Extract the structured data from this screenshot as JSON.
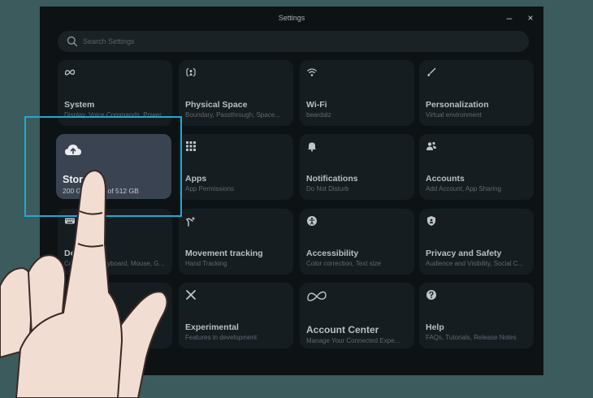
{
  "window": {
    "title": "Settings",
    "minimize_label": "–",
    "close_label": "×"
  },
  "search": {
    "placeholder": "Search Settings"
  },
  "cards": [
    {
      "title": "System",
      "subtitle": "Display, Voice Commands, Power",
      "icon": "meta-icon"
    },
    {
      "title": "Physical Space",
      "subtitle": "Boundary, Passthrough, Space...",
      "icon": "boundary-icon"
    },
    {
      "title": "Wi-Fi",
      "subtitle": "beardalz",
      "icon": "wifi-icon"
    },
    {
      "title": "Personalization",
      "subtitle": "Virtual environment",
      "icon": "brush-icon"
    },
    {
      "title": "Storage",
      "subtitle": "200 GB free of 512 GB",
      "icon": "cloud-upload-icon"
    },
    {
      "title": "Apps",
      "subtitle": "App Permissions",
      "icon": "apps-grid-icon"
    },
    {
      "title": "Notifications",
      "subtitle": "Do Not Disturb",
      "icon": "bell-icon"
    },
    {
      "title": "Accounts",
      "subtitle": "Add Account, App Sharing",
      "icon": "people-icon"
    },
    {
      "title": "Devices",
      "subtitle": "Controllers, Keyboard, Mouse, G...",
      "icon": "keyboard-icon"
    },
    {
      "title": "Movement tracking",
      "subtitle": "Hand Tracking",
      "icon": "movement-icon"
    },
    {
      "title": "Accessibility",
      "subtitle": "Color correction, Text size",
      "icon": "accessibility-icon"
    },
    {
      "title": "Privacy and Safety",
      "subtitle": "Audience and Visibility, Social C...",
      "icon": "shield-icon"
    },
    {
      "title": "",
      "subtitle": "",
      "icon": ""
    },
    {
      "title": "Experimental",
      "subtitle": "Features in development",
      "icon": "experimental-icon"
    },
    {
      "title": "Account Center",
      "subtitle": "Manage Your Connected Expe...",
      "icon": "meta-logo-icon"
    },
    {
      "title": "Help",
      "subtitle": "FAQs, Tutorials, Release Notes",
      "icon": "help-icon"
    }
  ],
  "storage_card": {
    "title": "Storage",
    "subtitle": "200 GB free of 512 GB",
    "visible_title": "Stora",
    "visible_sub_left": "200 G",
    "visible_sub_right": "of 512 GB"
  },
  "colors": {
    "background": "#3c5b5c",
    "window": "#0d1215",
    "card": "#161d21",
    "highlight_card": "#3a4352",
    "highlight_box": "#1fa9d6"
  }
}
